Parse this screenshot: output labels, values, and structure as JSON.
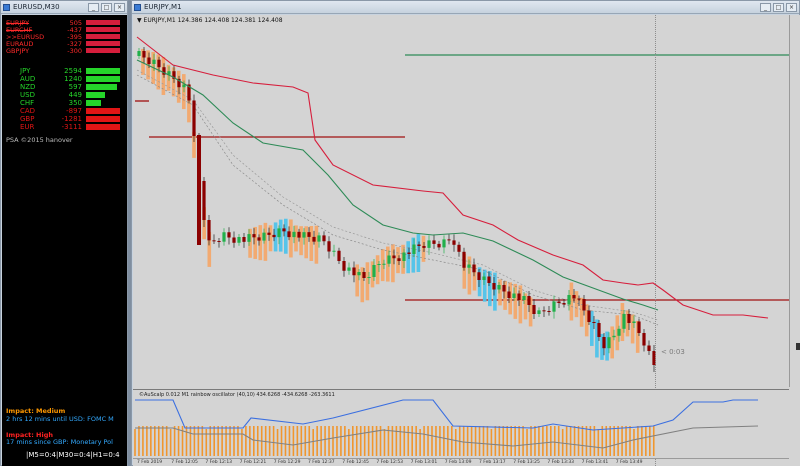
{
  "left_window": {
    "title": "EURUSD,M30",
    "pairs": [
      {
        "name": "EURJPY",
        "value": "505",
        "strike": true
      },
      {
        "name": "EURCHF",
        "value": "-437",
        "strike": true
      },
      {
        "name": ">>EURUSD",
        "value": "-395",
        "strike": false
      },
      {
        "name": "EURAUD",
        "value": "-327",
        "strike": false
      },
      {
        "name": "GBPJPY",
        "value": "-300",
        "strike": false
      }
    ],
    "currencies": [
      {
        "name": "JPY",
        "value": "2594",
        "color": "#25d52a",
        "level": 1.0
      },
      {
        "name": "AUD",
        "value": "1240",
        "color": "#25d52a",
        "level": 1.0
      },
      {
        "name": "NZD",
        "value": "597",
        "color": "#25d52a",
        "level": 0.9
      },
      {
        "name": "USD",
        "value": "449",
        "color": "#25d52a",
        "level": 0.55
      },
      {
        "name": "CHF",
        "value": "350",
        "color": "#25d52a",
        "level": 0.45
      },
      {
        "name": "CAD",
        "value": "-897",
        "color": "#e01515",
        "level": 1.0
      },
      {
        "name": "GBP",
        "value": "-1281",
        "color": "#e01515",
        "level": 1.0
      },
      {
        "name": "EUR",
        "value": "-3111",
        "color": "#e01515",
        "level": 1.0
      }
    ],
    "copyright": "PSA ©2015 hanover",
    "news1_title": "Impact: Medium",
    "news1_text": "2 hrs 12 mins until USD: FOMC M",
    "news2_title": "Impact: High",
    "news2_text": "17 mins since GBP: Monetary Pol",
    "timeframes": "|M5=0:4|M30=0:4|H1=0:4"
  },
  "right_window": {
    "title": "EURJPY,M1",
    "chart_info": "▼ EURJPY,M1  124.386 124.408 124.381 124.408",
    "countdown": "< 0:03",
    "osc_label": "©AuScalp 0.012  M1 rainbow oscillator (40,10) 434.6268 -434.6268 -263.3611",
    "x_labels": [
      "7 Feb 2019",
      "7 Feb 12:05",
      "7 Feb 12:13",
      "7 Feb 12:21",
      "7 Feb 12:29",
      "7 Feb 12:37",
      "7 Feb 12:45",
      "7 Feb 12:53",
      "7 Feb 13:01",
      "7 Feb 13:09",
      "7 Feb 13:17",
      "7 Feb 13:25",
      "7 Feb 13:33",
      "7 Feb 13:41",
      "7 Feb 13:49"
    ]
  },
  "colors": {
    "bull": "#21b04b",
    "bear": "#8b0000",
    "band_orange": "#f3a86b",
    "band_blue": "#4fc3ea",
    "envelope": "#d61e3c",
    "ma_green": "#2e8b57",
    "level_green": "#2e8b57",
    "level_red": "#a01010",
    "osc_line": "#3b6fe0",
    "news_title1": "#ff9900",
    "news_text": "#33aaff",
    "news_title2": "#ff2222"
  }
}
